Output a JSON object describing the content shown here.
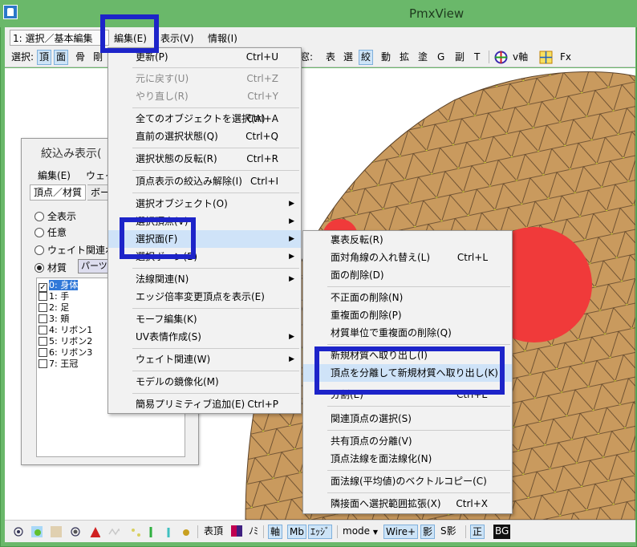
{
  "window": {
    "title": "PmxView"
  },
  "menubar": {
    "mode_select": "1: 選択／基本編集",
    "menus": [
      "編集(E)",
      "表示(V)",
      "情報(I)"
    ]
  },
  "toolbar": {
    "items": [
      "選択:",
      "頂",
      "面",
      "骨",
      "剛",
      "窓:",
      "表",
      "選",
      "絞",
      "動",
      "拡",
      "塗",
      "G",
      "副",
      "T",
      "v軸",
      "Fx"
    ]
  },
  "panel": {
    "title": "絞込み表示(",
    "menu": [
      "編集(E)",
      "ウェイ"
    ],
    "tabs": [
      "頂点／材質",
      "ボー"
    ],
    "radios": [
      "全表示",
      "任意",
      "ウェイト関連ボー",
      "材質"
    ],
    "parts_button": "パーツ絞",
    "materials": [
      "0: 身体",
      "1: 手",
      "2: 足",
      "3: 頬",
      "4: リボン1",
      "5: リボン2",
      "6: リボン3",
      "7: 王冠"
    ]
  },
  "edit_menu": {
    "items": [
      {
        "label": "更新(P)",
        "shortcut": "Ctrl+U"
      },
      {
        "label": "元に戻す(U)",
        "shortcut": "Ctrl+Z"
      },
      {
        "label": "やり直し(R)",
        "shortcut": "Ctrl+Y"
      },
      {
        "label": "全てのオブジェクトを選択(A)",
        "shortcut": "Ctrl+A"
      },
      {
        "label": "直前の選択状態(Q)",
        "shortcut": "Ctrl+Q"
      },
      {
        "label": "選択状態の反転(R)",
        "shortcut": "Ctrl+R"
      },
      {
        "label": "頂点表示の絞込み解除(I)",
        "shortcut": "Ctrl+I"
      },
      {
        "label": "選択オブジェクト(O)",
        "shortcut": ""
      },
      {
        "label": "選択頂点(V)",
        "shortcut": ""
      },
      {
        "label": "選択面(F)",
        "shortcut": ""
      },
      {
        "label": "選択ボーン(B)",
        "shortcut": ""
      },
      {
        "label": "法線関連(N)",
        "shortcut": ""
      },
      {
        "label": "エッジ倍率変更頂点を表示(E)",
        "shortcut": ""
      },
      {
        "label": "モーフ編集(K)",
        "shortcut": ""
      },
      {
        "label": "UV表情作成(S)",
        "shortcut": ""
      },
      {
        "label": "ウェイト関連(W)",
        "shortcut": ""
      },
      {
        "label": "モデルの鏡像化(M)",
        "shortcut": ""
      },
      {
        "label": "簡易プリミティブ追加(E)",
        "shortcut": "Ctrl+P"
      }
    ]
  },
  "face_submenu": {
    "items": [
      {
        "label": "裏表反転(R)",
        "shortcut": ""
      },
      {
        "label": "面対角線の入れ替え(L)",
        "shortcut": "Ctrl+L"
      },
      {
        "label": "面の削除(D)",
        "shortcut": ""
      },
      {
        "label": "不正面の削除(N)",
        "shortcut": ""
      },
      {
        "label": "重複面の削除(P)",
        "shortcut": ""
      },
      {
        "label": "材質単位で重複面の削除(Q)",
        "shortcut": ""
      },
      {
        "label": "新規材質へ取り出し(I)",
        "shortcut": ""
      },
      {
        "label": "頂点を分離して新規材質へ取り出し(K)",
        "shortcut": ""
      },
      {
        "label": "分割(E)",
        "shortcut": "Ctrl+E"
      },
      {
        "label": "関連頂点の選択(S)",
        "shortcut": ""
      },
      {
        "label": "共有頂点の分離(V)",
        "shortcut": ""
      },
      {
        "label": "頂点法線を面法線化(N)",
        "shortcut": ""
      },
      {
        "label": "面法線(平均値)のベクトルコピー(C)",
        "shortcut": ""
      },
      {
        "label": "隣接面へ選択範囲拡張(X)",
        "shortcut": "Ctrl+X"
      }
    ]
  },
  "statusbar": {
    "items": [
      "表頂",
      "ﾉﾐ",
      "軸",
      "Mb",
      "ｴｯｼﾞ",
      "mode",
      "Wire+",
      "影",
      "S影",
      "正",
      "BG"
    ]
  },
  "colors": {
    "title_bar": "#6ab86a",
    "mesh_fill": "#c99a5e",
    "mesh_line": "#5a4128",
    "selection_red": "#f03a3a",
    "highlight_box": "#1d24c9"
  }
}
